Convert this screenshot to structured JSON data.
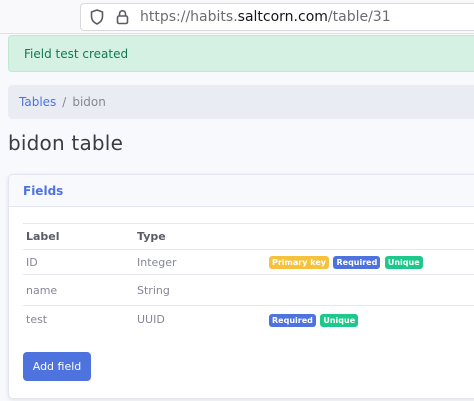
{
  "browser": {
    "url_prefix": "https://habits.",
    "url_host": "saltcorn.com",
    "url_path": "/table/31"
  },
  "alert": {
    "message": "Field test created"
  },
  "breadcrumb": {
    "items": [
      {
        "label": "Tables"
      },
      {
        "label": "bidon"
      }
    ],
    "separator": "/"
  },
  "page": {
    "title": "bidon table"
  },
  "card": {
    "header": "Fields",
    "columns": [
      "Label",
      "Type"
    ],
    "rows": [
      {
        "label": "ID",
        "type": "Integer",
        "badges": [
          "Primary key",
          "Required",
          "Unique"
        ]
      },
      {
        "label": "name",
        "type": "String",
        "badges": []
      },
      {
        "label": "test",
        "type": "UUID",
        "badges": [
          "Required",
          "Unique"
        ]
      }
    ],
    "add_button": "Add field"
  },
  "colors": {
    "primary": "#4e73df",
    "success_bg": "#d4f1e3",
    "badge_primary_key": "#f6c23e",
    "badge_required": "#4e73df",
    "badge_unique": "#1cc88a"
  },
  "icons": {
    "tracking_protection": "shield-icon",
    "connection": "lock-icon"
  }
}
